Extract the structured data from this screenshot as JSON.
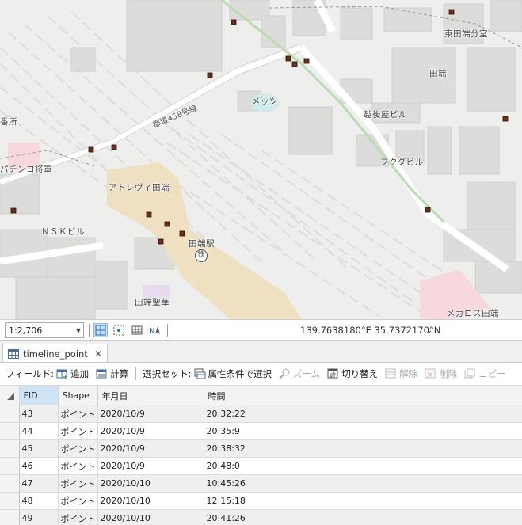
{
  "map": {
    "labels": {
      "higashi_tabata_2": "東田端分室",
      "tabata_area": "田端",
      "echigoya": "越後屋ビル",
      "fukuda": "フクダビル",
      "mets": "メッツ",
      "atre": "アトレヴィ田端",
      "nsk": "ＮＳＫビル",
      "pachinko": "パチンコ将軍",
      "police": "番所",
      "tabata_station": "田端駅",
      "seika": "田端聖華",
      "megalos": "メガロス田端",
      "route": "都道458号線"
    },
    "station_glyph": "鉄"
  },
  "status_bar": {
    "scale": "1:2,706",
    "coordinates": "139.7638180°E 35.7372170°N"
  },
  "table_tab": {
    "title": "timeline_point"
  },
  "toolbar": {
    "field_label": "フィールド:",
    "add": "追加",
    "calculate": "計算",
    "selection_label": "選択セット:",
    "select_by_attribute": "属性条件で選択",
    "zoom": "ズーム",
    "switch": "切り替え",
    "clear": "解除",
    "delete": "削除",
    "copy": "コピー"
  },
  "grid": {
    "columns": [
      "FID",
      "Shape",
      "年月日",
      "時間"
    ],
    "rows": [
      [
        "43",
        "ポイント",
        "2020/10/9",
        "20:32:22"
      ],
      [
        "44",
        "ポイント",
        "2020/10/9",
        "20:35:9"
      ],
      [
        "45",
        "ポイント",
        "2020/10/9",
        "20:38:32"
      ],
      [
        "46",
        "ポイント",
        "2020/10/9",
        "20:48:0"
      ],
      [
        "47",
        "ポイント",
        "2020/10/10",
        "10:45:26"
      ],
      [
        "48",
        "ポイント",
        "2020/10/10",
        "12:15:18"
      ],
      [
        "49",
        "ポイント",
        "2020/10/10",
        "20:41:26"
      ]
    ]
  },
  "colors": {
    "point": "#6b2f1a",
    "station_building": "#efe0c2",
    "highlight_pink": "#f6d8de",
    "rail_green": "#b9dcb0",
    "selected_header": "#cde4f7"
  }
}
